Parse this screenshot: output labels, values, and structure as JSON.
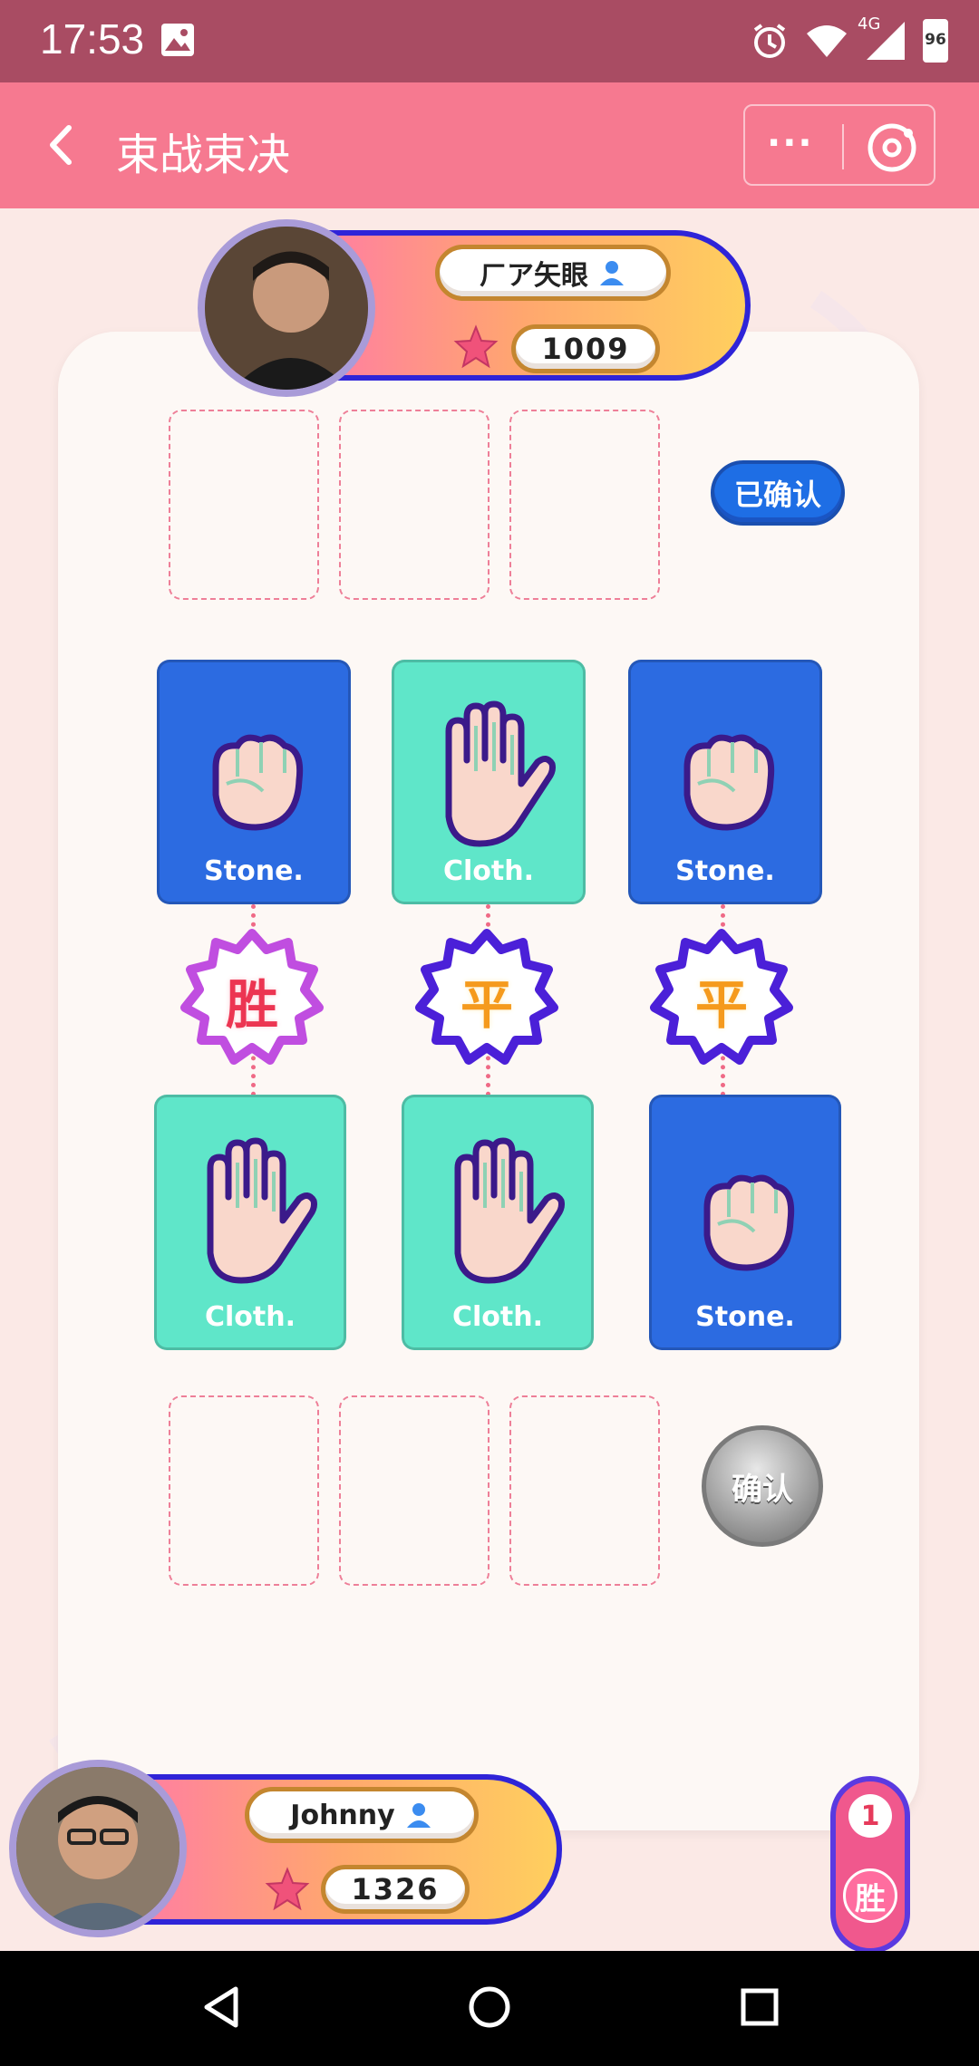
{
  "status_bar": {
    "time": "17:53",
    "network": "4G",
    "battery": "96"
  },
  "title_bar": {
    "title": "束战束决",
    "more_label": "···"
  },
  "opponent": {
    "name": "ㄏア矢眼",
    "score": "1009",
    "status": "已确认"
  },
  "player": {
    "name": "Johnny",
    "score": "1326",
    "confirm_label": "确认",
    "win_count": "1",
    "win_label": "胜"
  },
  "rounds": [
    {
      "top": "Stone.",
      "result": "胜",
      "bottom": "Cloth."
    },
    {
      "top": "Cloth.",
      "result": "平",
      "bottom": "Cloth."
    },
    {
      "top": "Stone.",
      "result": "平",
      "bottom": "Stone."
    }
  ],
  "colors": {
    "status_bar": "#a94c63",
    "title_bar": "#f67990",
    "stone_card": "#2c6be1",
    "cloth_card": "#5fe6c9",
    "win": "#ec3552",
    "draw": "#f59a1d"
  }
}
